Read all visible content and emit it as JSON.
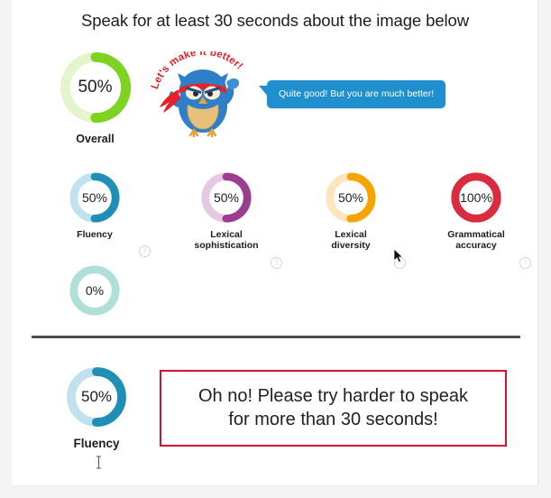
{
  "header": {
    "title": "Speak for at least 30 seconds about the image below"
  },
  "mascot": {
    "arc_text": "Let's make it better!",
    "alt": "ninja-owl-mascot",
    "headband_color": "#e8202a",
    "body_color": "#2f7fc8"
  },
  "bubble": {
    "text": "Quite good! But you are much better!",
    "color": "#1f8fce"
  },
  "overall": {
    "value": "50%",
    "percent": 50,
    "label": "Overall",
    "arc_color": "#7ed321",
    "track_color": "#e4f5cd"
  },
  "metrics": [
    {
      "id": "fluency",
      "value": "50%",
      "percent": 50,
      "label": "Fluency",
      "label_line2": "",
      "arc_color": "#1f8fb5",
      "track_color": "#bfe2ee",
      "help": "?"
    },
    {
      "id": "lexical-sophistication",
      "value": "50%",
      "percent": 50,
      "label": "Lexical",
      "label_line2": "sophistication",
      "arc_color": "#9b3e8f",
      "track_color": "#e5c9e2",
      "help": "?"
    },
    {
      "id": "lexical-diversity",
      "value": "50%",
      "percent": 50,
      "label": "Lexical",
      "label_line2": "diversity",
      "arc_color": "#f5a400",
      "track_color": "#fde5bd",
      "help": "?"
    },
    {
      "id": "grammatical-accuracy",
      "value": "100%",
      "percent": 100,
      "label": "Grammatical",
      "label_line2": "accuracy",
      "arc_color": "#db2b3f",
      "track_color": "#db2b3f",
      "help": "?"
    }
  ],
  "zero_metric": {
    "value": "0%",
    "percent": 0,
    "label": "",
    "arc_color": "#aee0d8",
    "track_color": "#aee0d8"
  },
  "bottom": {
    "gauge": {
      "value": "50%",
      "percent": 50,
      "label": "Fluency",
      "arc_color": "#1f8fb5",
      "track_color": "#bfe2ee"
    },
    "alert": {
      "line1": "Oh no! Please try harder to speak",
      "line2": "for more than 30 seconds!",
      "border_color": "#d81130"
    }
  }
}
